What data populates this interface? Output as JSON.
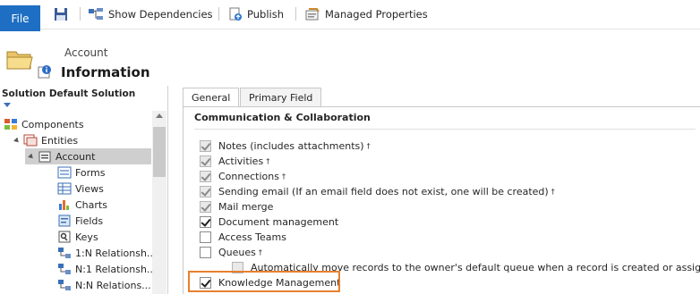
{
  "toolbar": {
    "file_label": "File",
    "save_icon": "save-icon",
    "show_dependencies_label": "Show Dependencies",
    "publish_label": "Publish",
    "managed_properties_label": "Managed Properties"
  },
  "header": {
    "entity_name": "Account",
    "title": "Information"
  },
  "nav": {
    "title": "Solution Default Solution",
    "items": [
      {
        "label": "Components",
        "icon": "components-icon",
        "level": 0
      },
      {
        "label": "Entities",
        "icon": "entities-icon",
        "level": 1
      },
      {
        "label": "Account",
        "icon": "account-icon",
        "level": 2,
        "selected": true
      },
      {
        "label": "Forms",
        "icon": "forms-icon",
        "level": 3
      },
      {
        "label": "Views",
        "icon": "views-icon",
        "level": 3
      },
      {
        "label": "Charts",
        "icon": "charts-icon",
        "level": 3
      },
      {
        "label": "Fields",
        "icon": "fields-icon",
        "level": 3
      },
      {
        "label": "Keys",
        "icon": "keys-icon",
        "level": 3
      },
      {
        "label": "1:N Relationsh...",
        "icon": "relationship-icon",
        "level": 3
      },
      {
        "label": "N:1 Relationsh...",
        "icon": "relationship-icon",
        "level": 3
      },
      {
        "label": "N:N Relations...",
        "icon": "relationship-icon",
        "level": 3
      }
    ]
  },
  "tabs": [
    {
      "label": "General",
      "active": true
    },
    {
      "label": "Primary Field",
      "active": false
    }
  ],
  "section": {
    "title": "Communication & Collaboration",
    "dagger": "†",
    "options": [
      {
        "label": "Notes (includes attachments)",
        "checked": true,
        "disabled": true,
        "dagger": true
      },
      {
        "label": "Activities",
        "checked": true,
        "disabled": true,
        "dagger": true
      },
      {
        "label": "Connections",
        "checked": true,
        "disabled": true,
        "dagger": true
      },
      {
        "label": "Sending email (If an email field does not exist, one will be created)",
        "checked": true,
        "disabled": true,
        "dagger": true
      },
      {
        "label": "Mail merge",
        "checked": true,
        "disabled": true,
        "dagger": false
      },
      {
        "label": "Document management",
        "checked": true,
        "disabled": false,
        "dagger": false
      },
      {
        "label": "Access Teams",
        "checked": false,
        "disabled": false,
        "dagger": false
      },
      {
        "label": "Queues",
        "checked": false,
        "disabled": false,
        "dagger": true
      },
      {
        "label": "Automatically move records to the owner's default queue when a record is created or assigned.",
        "checked": false,
        "disabled": true,
        "dagger": false
      },
      {
        "label": "Knowledge Management",
        "checked": true,
        "disabled": false,
        "dagger": false
      }
    ]
  },
  "colors": {
    "file_button": "#1e6fc3",
    "highlight": "#e8802d"
  }
}
